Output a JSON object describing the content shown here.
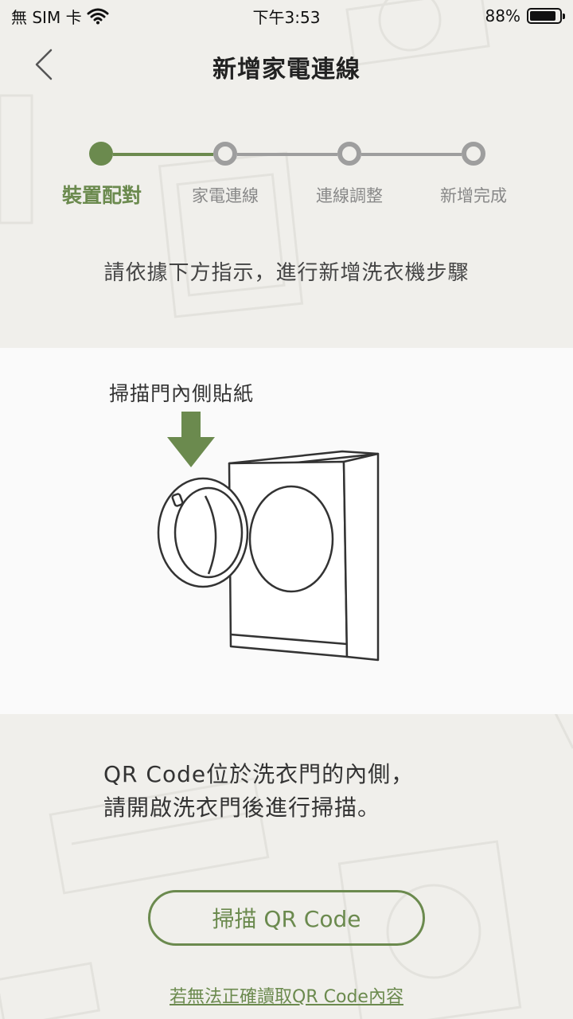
{
  "status_bar": {
    "carrier": "無 SIM 卡",
    "time": "下午3:53",
    "battery_percent_label": "88%",
    "battery_level": 0.88
  },
  "nav": {
    "title": "新增家電連線",
    "back_icon": "chevron-left-icon"
  },
  "stepper": {
    "active_color": "#6b8a4e",
    "inactive_color": "#9e9e9e",
    "steps": [
      {
        "label": "裝置配對",
        "state": "active"
      },
      {
        "label": "家電連線",
        "state": "inactive"
      },
      {
        "label": "連線調整",
        "state": "inactive"
      },
      {
        "label": "新增完成",
        "state": "inactive"
      }
    ]
  },
  "instruction": "請依據下方指示，進行新增洗衣機步驟",
  "illustration": {
    "sticker_label": "掃描門內側貼紙",
    "arrow_icon": "arrow-down-icon",
    "washer_icon": "washing-machine-icon"
  },
  "description": {
    "line1": "QR Code位於洗衣門的內側，",
    "line2": "請開啟洗衣門後進行掃描。"
  },
  "scan_button_label": "掃描 QR Code",
  "manual_link_label": "若無法正確讀取QR Code內容",
  "colors": {
    "accent": "#6b8a4e",
    "background": "#f0efeb",
    "panel": "#fafafa"
  }
}
